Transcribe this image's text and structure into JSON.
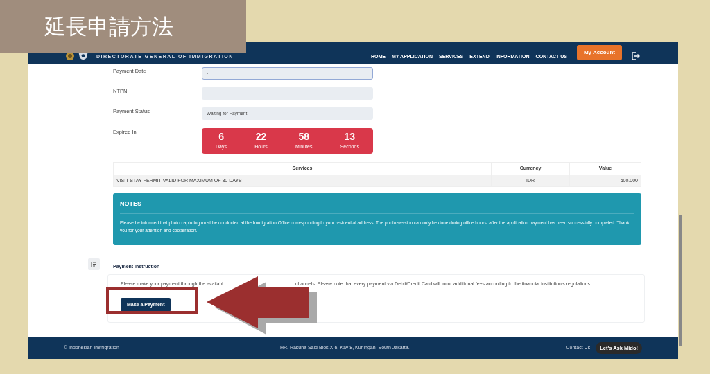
{
  "overlay_title": "延長申請方法",
  "header": {
    "agency": "DIRECTORATE GENERAL OF IMMIGRATION",
    "nav": [
      "HOME",
      "MY APPLICATION",
      "SERVICES",
      "EXTEND",
      "INFORMATION",
      "CONTACT US"
    ],
    "account_button": "My Account"
  },
  "fields": [
    {
      "label": "Payment Date",
      "value": "-",
      "focused": true
    },
    {
      "label": "NTPN",
      "value": "-",
      "focused": false
    },
    {
      "label": "Payment Status",
      "value": "Waiting for Payment",
      "focused": false
    }
  ],
  "expiry": {
    "label": "Expired In",
    "units": [
      {
        "value": "6",
        "unit": "Days"
      },
      {
        "value": "22",
        "unit": "Hours"
      },
      {
        "value": "58",
        "unit": "Minutes"
      },
      {
        "value": "13",
        "unit": "Seconds"
      }
    ]
  },
  "table": {
    "columns": [
      "Services",
      "Currency",
      "Value"
    ],
    "rows": [
      [
        "VISIT STAY PERMIT VALID FOR MAXIMUM OF 30 DAYS",
        "IDR",
        "500.000"
      ]
    ]
  },
  "notes": {
    "title": "NOTES",
    "text": "Please be informed that photo capturing must be conducted at the Immigration Office corresponding to your residential address. The photo session can only be done during office hours, after the application payment has been successfully completed. Thank you for your attention and cooperation."
  },
  "payment_instruction": {
    "title": "Payment Instruction",
    "text_parts": [
      "Please make your payment through the availabl",
      "channels. Please note that every payment via Debit/Credit Card will incur additional fees according to the financial institution's regulations."
    ],
    "button": "Make a Payment"
  },
  "footer": {
    "copyright": "© Indonesian Immigration",
    "address": "HR. Rasuna Said Blok X-6, Kav 8, Kuningan, South Jakarta.",
    "contact": "Contact Us",
    "chat": "Let's Ask Mido!"
  }
}
